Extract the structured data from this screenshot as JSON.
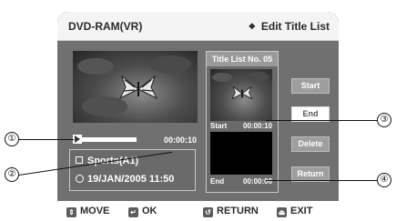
{
  "header": {
    "left_title": "DVD-RAM(VR)",
    "right_title": "Edit Title List"
  },
  "player": {
    "current_time": "00:00:10",
    "progress": 0.0
  },
  "info": {
    "title": "Sports(A1)",
    "date": "19/JAN/2005 11:50"
  },
  "title_list": {
    "heading": "Title List No. 05",
    "start_label": "Start",
    "start_time": "00:00:10",
    "end_label": "End",
    "end_time": "00:00:00"
  },
  "buttons": {
    "start": "Start",
    "end": "End",
    "delete": "Delete",
    "return": "Return"
  },
  "footer": {
    "move": "MOVE",
    "ok": "OK",
    "return": "RETURN",
    "exit": "EXIT"
  },
  "callouts": [
    "①",
    "②",
    "③",
    "④"
  ],
  "icons": [
    "diamond-icon",
    "play-icon",
    "title-icon",
    "clock-icon",
    "move-icon",
    "ok-icon",
    "return-icon",
    "exit-icon"
  ]
}
